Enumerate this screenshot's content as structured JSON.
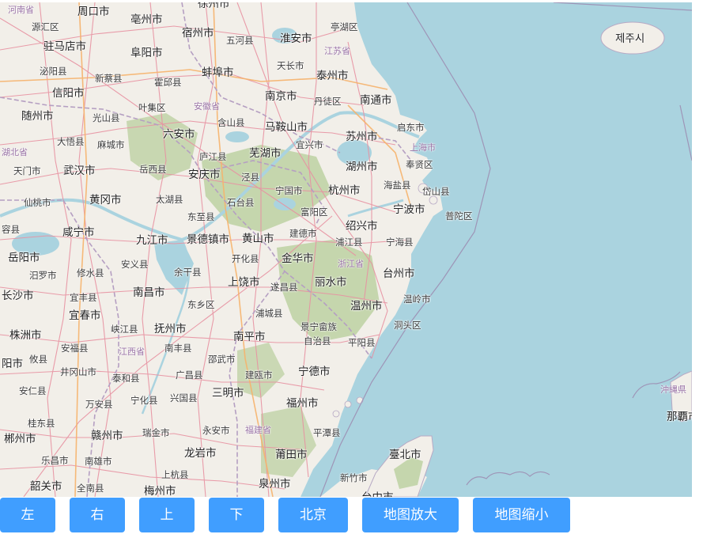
{
  "map": {
    "places": [
      {
        "id": "henan",
        "label": "河南省",
        "cls": "prov"
      },
      {
        "id": "zhoukou",
        "label": "周口市",
        "cls": "city"
      },
      {
        "id": "bozhou",
        "label": "亳州市",
        "cls": "city"
      },
      {
        "id": "xuzhou",
        "label": "徐州市",
        "cls": "city"
      },
      {
        "id": "tinghu",
        "label": "亭湖区",
        "cls": "county"
      },
      {
        "id": "jeju",
        "label": "제주시",
        "cls": "city"
      },
      {
        "id": "yuanhui",
        "label": "源汇区",
        "cls": "county"
      },
      {
        "id": "suzhou_ah",
        "label": "宿州市",
        "cls": "city"
      },
      {
        "id": "wuhe",
        "label": "五河县",
        "cls": "county"
      },
      {
        "id": "huaian",
        "label": "淮安市",
        "cls": "city"
      },
      {
        "id": "zhumadian",
        "label": "驻马店市",
        "cls": "city"
      },
      {
        "id": "fuyang",
        "label": "阜阳市",
        "cls": "city"
      },
      {
        "id": "jiangsu",
        "label": "江苏省",
        "cls": "prov"
      },
      {
        "id": "tianchang",
        "label": "天长市",
        "cls": "county"
      },
      {
        "id": "bengbu",
        "label": "蚌埠市",
        "cls": "city"
      },
      {
        "id": "taizhou_js",
        "label": "泰州市",
        "cls": "city"
      },
      {
        "id": "biyang",
        "label": "泌阳县",
        "cls": "county"
      },
      {
        "id": "xincai",
        "label": "新蔡县",
        "cls": "county"
      },
      {
        "id": "huoqiu",
        "label": "霍邱县",
        "cls": "county"
      },
      {
        "id": "xinyang",
        "label": "信阳市",
        "cls": "city"
      },
      {
        "id": "nanjing",
        "label": "南京市",
        "cls": "city"
      },
      {
        "id": "dantu",
        "label": "丹徒区",
        "cls": "county"
      },
      {
        "id": "nantong",
        "label": "南通市",
        "cls": "city"
      },
      {
        "id": "yeji",
        "label": "叶集区",
        "cls": "county"
      },
      {
        "id": "anhui",
        "label": "安徽省",
        "cls": "prov"
      },
      {
        "id": "suizhou",
        "label": "随州市",
        "cls": "city"
      },
      {
        "id": "guangshan",
        "label": "光山县",
        "cls": "county"
      },
      {
        "id": "hanshan",
        "label": "含山县",
        "cls": "county"
      },
      {
        "id": "maanshan",
        "label": "马鞍山市",
        "cls": "city"
      },
      {
        "id": "qidong",
        "label": "启东市",
        "cls": "county"
      },
      {
        "id": "liuan",
        "label": "六安市",
        "cls": "city"
      },
      {
        "id": "suzhou_js",
        "label": "苏州市",
        "cls": "city"
      },
      {
        "id": "dawu",
        "label": "大悟县",
        "cls": "county"
      },
      {
        "id": "macheng",
        "label": "麻城市",
        "cls": "county"
      },
      {
        "id": "lujiang",
        "label": "庐江县",
        "cls": "county"
      },
      {
        "id": "yixing",
        "label": "宜兴市",
        "cls": "county"
      },
      {
        "id": "wuhu",
        "label": "芜湖市",
        "cls": "city"
      },
      {
        "id": "shanghai",
        "label": "上海市",
        "cls": "prov"
      },
      {
        "id": "hubei",
        "label": "湖北省",
        "cls": "prov"
      },
      {
        "id": "fengxian",
        "label": "奉贤区",
        "cls": "county"
      },
      {
        "id": "tianmen",
        "label": "天门市",
        "cls": "county"
      },
      {
        "id": "wuhan",
        "label": "武汉市",
        "cls": "city"
      },
      {
        "id": "yuexi",
        "label": "岳西县",
        "cls": "county"
      },
      {
        "id": "anqing",
        "label": "安庆市",
        "cls": "city"
      },
      {
        "id": "jingxian",
        "label": "泾县",
        "cls": "county"
      },
      {
        "id": "huzhou",
        "label": "湖州市",
        "cls": "city"
      },
      {
        "id": "haiyan",
        "label": "海盐县",
        "cls": "county"
      },
      {
        "id": "daishan",
        "label": "岱山县",
        "cls": "county"
      },
      {
        "id": "xiantao",
        "label": "仙桃市",
        "cls": "county"
      },
      {
        "id": "huanggang",
        "label": "黄冈市",
        "cls": "city"
      },
      {
        "id": "taihu",
        "label": "太湖县",
        "cls": "county"
      },
      {
        "id": "ningguo",
        "label": "宁国市",
        "cls": "county"
      },
      {
        "id": "hangzhou",
        "label": "杭州市",
        "cls": "city"
      },
      {
        "id": "shitai",
        "label": "石台县",
        "cls": "county"
      },
      {
        "id": "fuyang_zj",
        "label": "富阳区",
        "cls": "county"
      },
      {
        "id": "ningbo",
        "label": "宁波市",
        "cls": "city"
      },
      {
        "id": "putuo",
        "label": "普陀区",
        "cls": "county"
      },
      {
        "id": "rong",
        "label": "容县",
        "cls": "county"
      },
      {
        "id": "xianning",
        "label": "咸宁市",
        "cls": "city"
      },
      {
        "id": "dongzhi",
        "label": "东至县",
        "cls": "county"
      },
      {
        "id": "shaoxing",
        "label": "绍兴市",
        "cls": "city"
      },
      {
        "id": "jiujiang",
        "label": "九江市",
        "cls": "city"
      },
      {
        "id": "jingdezhen",
        "label": "景德镇市",
        "cls": "city"
      },
      {
        "id": "huangshan",
        "label": "黄山市",
        "cls": "city"
      },
      {
        "id": "jiande",
        "label": "建德市",
        "cls": "county"
      },
      {
        "id": "pujiang",
        "label": "浦江县",
        "cls": "county"
      },
      {
        "id": "ninghai",
        "label": "宁海县",
        "cls": "county"
      },
      {
        "id": "yueyang",
        "label": "岳阳市",
        "cls": "city"
      },
      {
        "id": "kaihua",
        "label": "开化县",
        "cls": "county"
      },
      {
        "id": "jinhua",
        "label": "金华市",
        "cls": "city"
      },
      {
        "id": "anyi",
        "label": "安义县",
        "cls": "county"
      },
      {
        "id": "zhejiang",
        "label": "浙江省",
        "cls": "prov"
      },
      {
        "id": "miluo",
        "label": "汨罗市",
        "cls": "county"
      },
      {
        "id": "xiushui",
        "label": "修水县",
        "cls": "county"
      },
      {
        "id": "yugan",
        "label": "余干县",
        "cls": "county"
      },
      {
        "id": "taizhou_zj",
        "label": "台州市",
        "cls": "city"
      },
      {
        "id": "shangrao",
        "label": "上饶市",
        "cls": "city"
      },
      {
        "id": "lishui",
        "label": "丽水市",
        "cls": "city"
      },
      {
        "id": "suichang",
        "label": "遂昌县",
        "cls": "county"
      },
      {
        "id": "changsha",
        "label": "长沙市",
        "cls": "city"
      },
      {
        "id": "nanchang",
        "label": "南昌市",
        "cls": "city"
      },
      {
        "id": "yifeng",
        "label": "宜丰县",
        "cls": "county"
      },
      {
        "id": "wenling",
        "label": "温岭市",
        "cls": "county"
      },
      {
        "id": "dongxiang",
        "label": "东乡区",
        "cls": "county"
      },
      {
        "id": "wenzhou",
        "label": "温州市",
        "cls": "city"
      },
      {
        "id": "yichun",
        "label": "宜春市",
        "cls": "city"
      },
      {
        "id": "pucheng",
        "label": "浦城县",
        "cls": "county"
      },
      {
        "id": "dongtou",
        "label": "洞头区",
        "cls": "county"
      },
      {
        "id": "jingning",
        "label": "景宁畲族",
        "cls": "county"
      },
      {
        "id": "zhuzhou",
        "label": "株洲市",
        "cls": "city"
      },
      {
        "id": "xiajiang",
        "label": "峡江县",
        "cls": "county"
      },
      {
        "id": "fuzhou_jx",
        "label": "抚州市",
        "cls": "city"
      },
      {
        "id": "nanping",
        "label": "南平市",
        "cls": "city"
      },
      {
        "id": "zizhi",
        "label": "自治县",
        "cls": "county"
      },
      {
        "id": "pingyang",
        "label": "平阳县",
        "cls": "county"
      },
      {
        "id": "anfu",
        "label": "安福县",
        "cls": "county"
      },
      {
        "id": "jiangxi",
        "label": "江西省",
        "cls": "prov"
      },
      {
        "id": "nanfeng",
        "label": "南丰县",
        "cls": "county"
      },
      {
        "id": "youxian",
        "label": "攸县",
        "cls": "county"
      },
      {
        "id": "shaowu",
        "label": "邵武市",
        "cls": "county"
      },
      {
        "id": "yangshi",
        "label": "阳市",
        "cls": "city"
      },
      {
        "id": "jinggangshan",
        "label": "井冈山市",
        "cls": "county"
      },
      {
        "id": "taihe",
        "label": "泰和县",
        "cls": "county"
      },
      {
        "id": "guangchang",
        "label": "广昌县",
        "cls": "county"
      },
      {
        "id": "jianou",
        "label": "建瓯市",
        "cls": "county"
      },
      {
        "id": "ningde",
        "label": "宁德市",
        "cls": "city"
      },
      {
        "id": "anren",
        "label": "安仁县",
        "cls": "county"
      },
      {
        "id": "ninghua",
        "label": "宁化县",
        "cls": "county"
      },
      {
        "id": "sanming",
        "label": "三明市",
        "cls": "city"
      },
      {
        "id": "wanan",
        "label": "万安县",
        "cls": "county"
      },
      {
        "id": "xingguo",
        "label": "兴国县",
        "cls": "county"
      },
      {
        "id": "fuzhou_fj",
        "label": "福州市",
        "cls": "city"
      },
      {
        "id": "okinawa",
        "label": "沖縄県",
        "cls": "prov"
      },
      {
        "id": "guidong",
        "label": "桂东县",
        "cls": "county"
      },
      {
        "id": "naha",
        "label": "那覇市",
        "cls": "city"
      },
      {
        "id": "ruijin",
        "label": "瑞金市",
        "cls": "county"
      },
      {
        "id": "yongan",
        "label": "永安市",
        "cls": "county"
      },
      {
        "id": "fujian",
        "label": "福建省",
        "cls": "prov"
      },
      {
        "id": "pingtan",
        "label": "平潭县",
        "cls": "county"
      },
      {
        "id": "chenzhou",
        "label": "郴州市",
        "cls": "city"
      },
      {
        "id": "ganzhou",
        "label": "赣州市",
        "cls": "city"
      },
      {
        "id": "longyan",
        "label": "龙岩市",
        "cls": "city"
      },
      {
        "id": "putian",
        "label": "莆田市",
        "cls": "city"
      },
      {
        "id": "taipei",
        "label": "臺北市",
        "cls": "city"
      },
      {
        "id": "lechang",
        "label": "乐昌市",
        "cls": "county"
      },
      {
        "id": "nanxiong",
        "label": "南雄市",
        "cls": "county"
      },
      {
        "id": "shanghang",
        "label": "上杭县",
        "cls": "county"
      },
      {
        "id": "xinzhu",
        "label": "新竹市",
        "cls": "county"
      },
      {
        "id": "shaoguan",
        "label": "韶关市",
        "cls": "city"
      },
      {
        "id": "quannan",
        "label": "全南县",
        "cls": "county"
      },
      {
        "id": "meizhou",
        "label": "梅州市",
        "cls": "city"
      },
      {
        "id": "quanzhou",
        "label": "泉州市",
        "cls": "city"
      },
      {
        "id": "taizhong",
        "label": "台中市",
        "cls": "city"
      }
    ]
  },
  "controls": {
    "left": "左",
    "right": "右",
    "up": "上",
    "down": "下",
    "beijing": "北京",
    "zoom_in": "地图放大",
    "zoom_out": "地图缩小"
  }
}
